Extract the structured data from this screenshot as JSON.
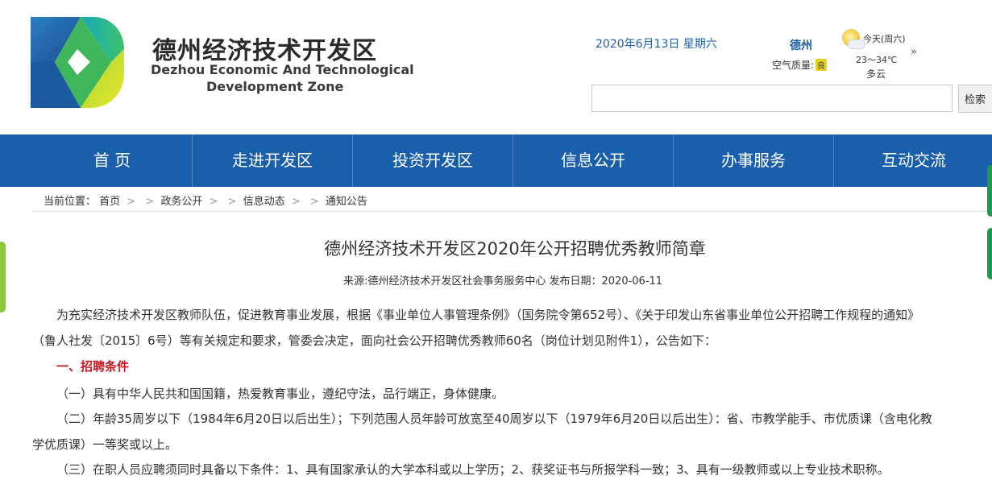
{
  "header": {
    "logo_cn": "德州经济技术开发区",
    "logo_en_line1": "Dezhou Economic And Technological",
    "logo_en_line2": "Development Zone",
    "date": "2020年6月13日 星期六",
    "weather": {
      "city": "德州",
      "air_quality_label": "空气质量:",
      "air_quality_value": "良",
      "today": "今天(周六)",
      "temp": "23～34℃",
      "desc": "多云",
      "more": "»",
      "icon": "partly-cloudy-icon"
    },
    "search": {
      "placeholder": "",
      "button_label": "检索"
    }
  },
  "nav": {
    "items": [
      {
        "label": "首 页"
      },
      {
        "label": "走进开发区"
      },
      {
        "label": "投资开发区"
      },
      {
        "label": "信息公开"
      },
      {
        "label": "办事服务"
      },
      {
        "label": "互动交流"
      }
    ]
  },
  "breadcrumb": {
    "prefix": "当前位置：",
    "items": [
      "首页",
      "政务公开",
      "信息动态",
      "通知公告"
    ],
    "arrow": ">"
  },
  "article": {
    "title": "德州经济技术开发区2020年公开招聘优秀教师简章",
    "meta": "来源:德州经济技术开发区社会事务服务中心   发布日期：2020-06-11",
    "paragraphs": [
      "为充实经济技术开发区教师队伍，促进教育事业发展，根据《事业单位人事管理条例》（国务院令第652号）、《关于印发山东省事业单位公开招聘工作规程的通知》",
      "（鲁人社发〔2015〕6号）等有关规定和要求，管委会决定，面向社会公开招聘优秀教师60名（岗位计划见附件1），公告如下：",
      "一、招聘条件",
      "（一）具有中华人民共和国国籍，热爱教育事业，遵纪守法，品行端正，身体健康。",
      "（二）年龄35周岁以下（1984年6月20日以后出生）；下列范围人员年龄可放宽至40周岁以下（1979年6月20日以后出生）：省、市教学能手、市优质课（含电化教",
      "学优质课）一等奖或以上。",
      "（三）在职人员应聘须同时具备以下条件：1、具有国家承认的大学本科或以上学历；2、获奖证书与所报学科一致；3、具有一级教师或以上专业技术职称。"
    ]
  },
  "colors": {
    "nav_bg": "#1a5fac",
    "accent_text": "#1f5fa8",
    "section_red": "#c8171e",
    "side_green": "#8dc63f"
  }
}
